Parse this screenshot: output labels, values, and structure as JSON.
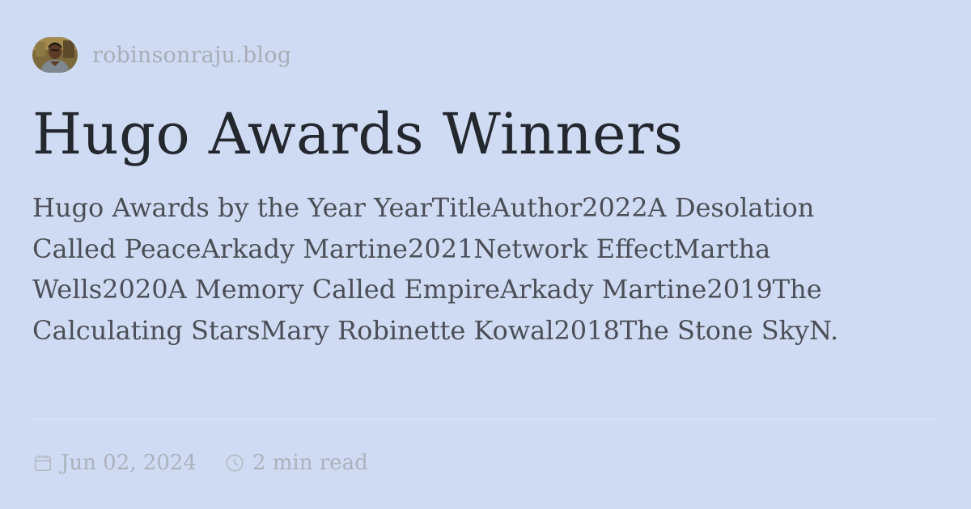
{
  "site": {
    "name": "robinsonraju.blog",
    "avatar_icon": "author-avatar-photo"
  },
  "post": {
    "title": "Hugo Awards Winners",
    "excerpt": "Hugo Awards by the Year YearTitleAuthor2022A Desolation Called PeaceArkady Martine2021Network EffectMartha Wells2020A Memory Called EmpireArkady Martine2019The Calculating StarsMary Robinette Kowal2018The Stone SkyN."
  },
  "meta": {
    "date": "Jun 02, 2024",
    "date_icon": "calendar-icon",
    "read_time": "2 min read",
    "read_time_icon": "clock-icon"
  },
  "colors": {
    "background": "#cfdbf2",
    "title": "#23272e",
    "excerpt": "#4a4f57",
    "muted": "#abb2bd"
  }
}
